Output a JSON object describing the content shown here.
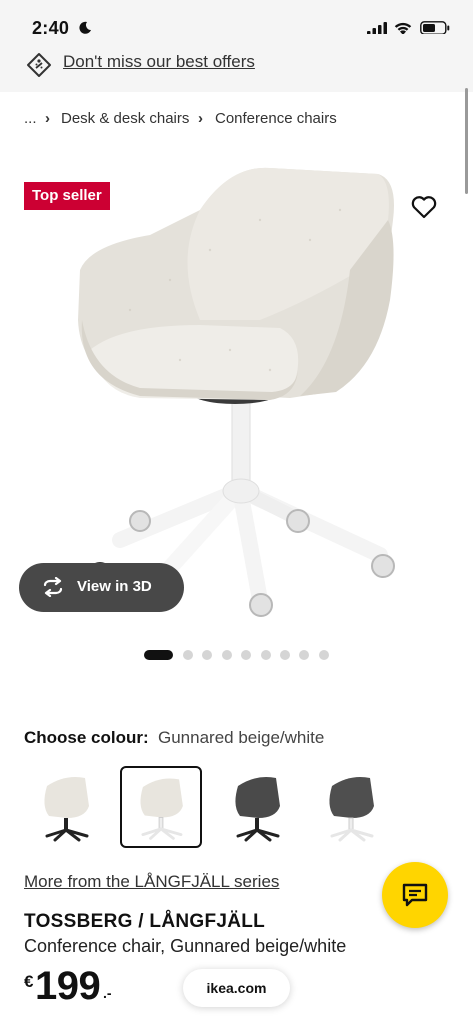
{
  "status_bar": {
    "time": "2:40"
  },
  "offer_banner": {
    "text": "Don't miss our best offers"
  },
  "breadcrumb": {
    "ellipsis": "...",
    "items": [
      "Desk & desk chairs",
      "Conference chairs"
    ],
    "separator": "›"
  },
  "product": {
    "badge": "Top seller",
    "view_3d_label": "View in 3D",
    "image_count": 10,
    "active_image": 1,
    "colour_label": "Choose colour:",
    "colour_value": "Gunnared beige/white",
    "swatches": [
      {
        "name": "beige-black",
        "selected": false
      },
      {
        "name": "beige-white",
        "selected": true
      },
      {
        "name": "dark-grey-black",
        "selected": false
      },
      {
        "name": "dark-grey-white",
        "selected": false
      }
    ],
    "series_link": "More from the LÅNGFJÄLL series",
    "name": "TOSSBERG / LÅNGFJÄLL",
    "description": "Conference chair, Gunnared beige/white",
    "price": {
      "currency": "€",
      "integer": "199",
      "decimal": ".-"
    }
  },
  "browser": {
    "url": "ikea.com"
  },
  "colors": {
    "badge_red": "#cc0033",
    "chat_yellow": "#ffd500",
    "view3d_bg": "#484848"
  }
}
